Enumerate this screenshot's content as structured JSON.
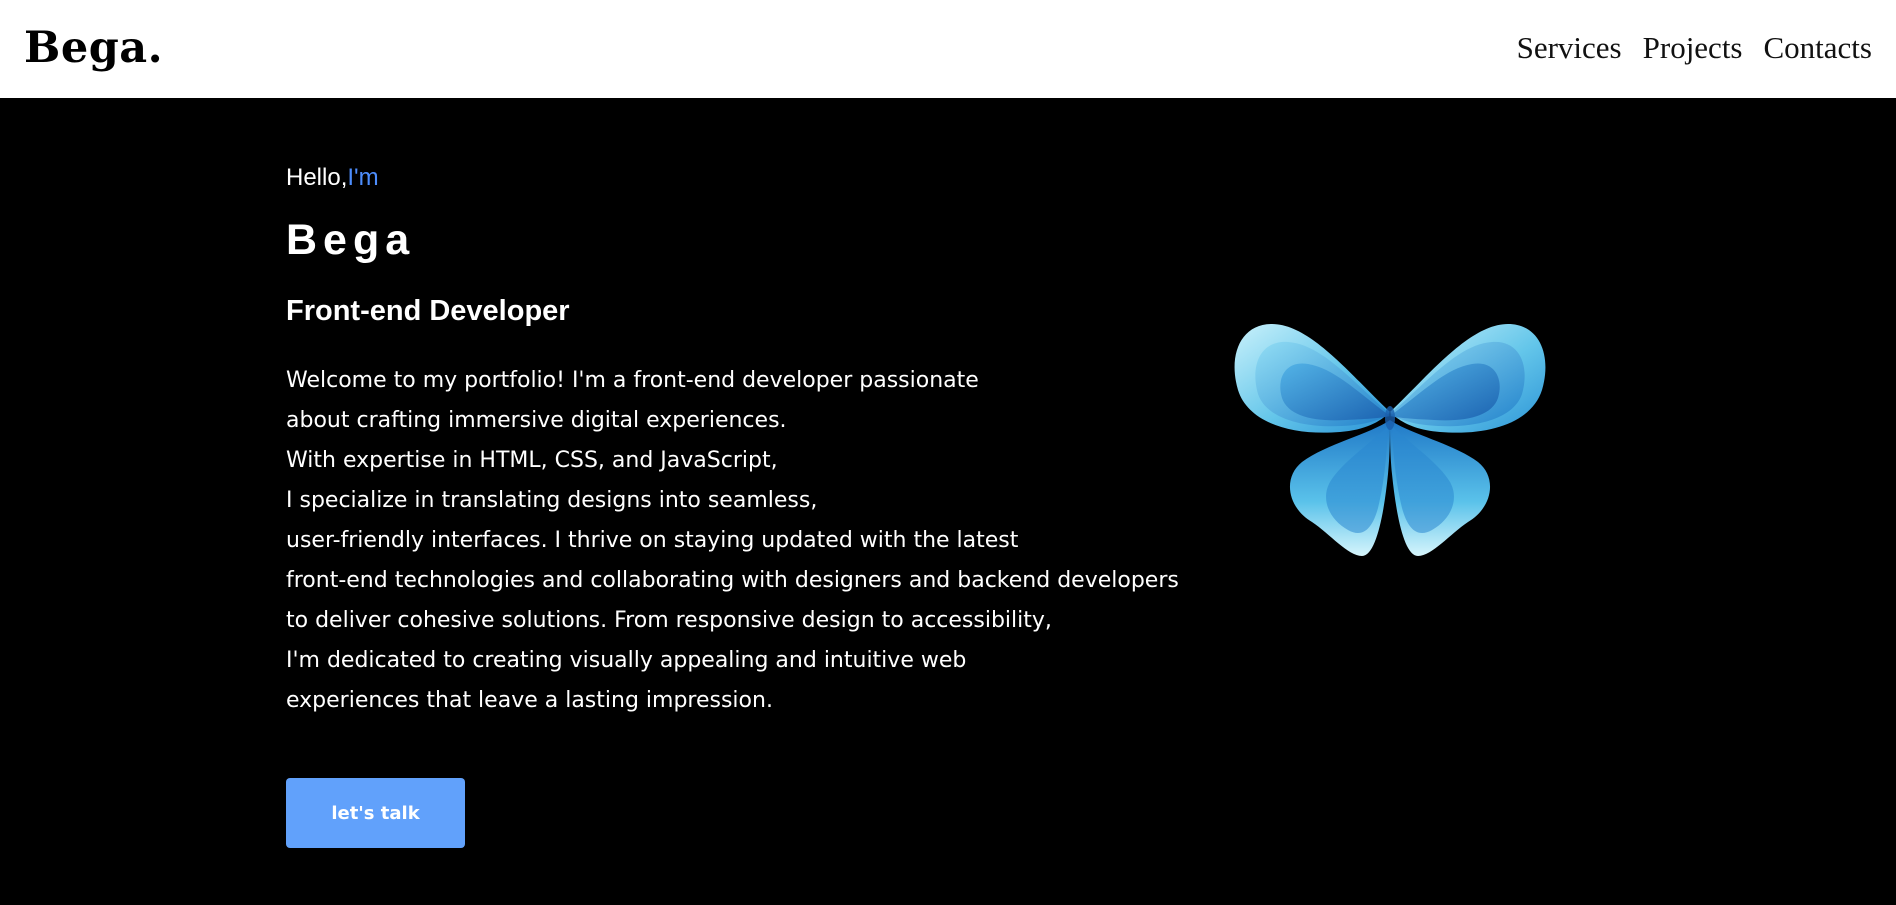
{
  "header": {
    "brand": "Bega.",
    "nav": [
      "Services",
      "Projects",
      "Contacts"
    ]
  },
  "hero": {
    "greeting": "Hello,",
    "greeting_accent": "I'm",
    "name": "Bega",
    "role": "Front-end Developer",
    "bio_lines": [
      "Welcome to my portfolio! I'm a front-end developer passionate",
      "about crafting immersive digital experiences.",
      "With expertise in HTML, CSS, and JavaScript,",
      "I specialize in translating designs into seamless,",
      "user-friendly interfaces. I thrive on staying updated with the latest",
      "front-end technologies and collaborating with designers and backend developers",
      "to deliver cohesive solutions. From responsive design to accessibility,",
      "I'm dedicated to creating visually appealing and intuitive web",
      "experiences that leave a lasting impression."
    ],
    "cta_label": "let's talk",
    "image": {
      "icon": "butterfly-logo"
    }
  },
  "colors": {
    "page_background": "#000000",
    "header_background": "#ffffff",
    "accent": "#4d8dfc",
    "button": "#61a1fb"
  }
}
